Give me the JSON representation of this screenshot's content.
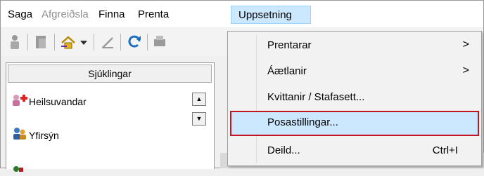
{
  "menubar": {
    "items": [
      {
        "label": "Saga",
        "state": "normal"
      },
      {
        "label": "Afgreiðsla",
        "state": "disabled"
      },
      {
        "label": "Finna",
        "state": "normal"
      },
      {
        "label": "Prenta",
        "state": "normal"
      },
      {
        "label": "Uppsetning",
        "state": "active"
      }
    ]
  },
  "panel": {
    "header": "Sjúklingar",
    "items": [
      {
        "label": "Heilsuvandar",
        "icon": "red-cross-person-icon"
      },
      {
        "label": "Yfirsýn",
        "icon": "people-icon"
      }
    ]
  },
  "dropdown": {
    "items": [
      {
        "label": "Prentarar",
        "submenu": ">",
        "shortcut": ""
      },
      {
        "label": "Áætlanir",
        "submenu": ">",
        "shortcut": ""
      },
      {
        "label": "Kvittanir / Stafasett...",
        "submenu": "",
        "shortcut": ""
      },
      {
        "label": "Posastillingar...",
        "submenu": "",
        "shortcut": "",
        "highlighted": true
      },
      {
        "label": "Deild...",
        "submenu": "",
        "shortcut": "Ctrl+I"
      }
    ]
  },
  "colors": {
    "menu_active_bg": "#cce8ff",
    "highlight_border": "#c4161c"
  }
}
